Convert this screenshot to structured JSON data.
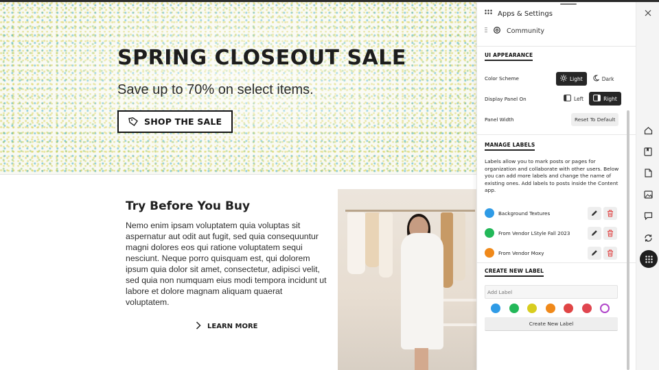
{
  "hero": {
    "title": "SPRING CLOSEOUT SALE",
    "subtitle": "Save up to 70% on select items.",
    "cta_label": "SHOP THE SALE"
  },
  "section": {
    "title": "Try Before You Buy",
    "body": "Nemo enim ipsam voluptatem quia voluptas sit aspernatur aut odit aut fugit, sed quia consequuntur magni dolores eos qui ratione voluptatem sequi nesciunt. Neque porro quisquam est, qui dolorem ipsum quia dolor sit amet, consectetur, adipisci velit, sed quia non numquam eius modi tempora incidunt ut labore et dolore magnam aliquam quaerat voluptatem.",
    "link_label": "LEARN MORE"
  },
  "panel": {
    "title": "Apps & Settings",
    "community_label": "Community",
    "ui_appearance": {
      "heading": "UI APPEARANCE",
      "color_scheme_label": "Color Scheme",
      "light_label": "Light",
      "dark_label": "Dark",
      "selected_scheme": "Light",
      "display_panel_label": "Display Panel On",
      "left_label": "Left",
      "right_label": "Right",
      "selected_side": "Right",
      "panel_width_label": "Panel Width",
      "reset_label": "Reset To Default"
    },
    "manage_labels": {
      "heading": "MANAGE LABELS",
      "description": "Labels allow you to mark posts or pages for organization and collaborate with other users. Below you can add more labels and change the name of existing ones. Add labels to posts inside the Content app.",
      "labels": [
        {
          "name": "Background Textures",
          "color": "#2f9be6"
        },
        {
          "name": "From Vendor LStyle Fall 2023",
          "color": "#23b859"
        },
        {
          "name": "From Vendor Moxy",
          "color": "#f0891a"
        }
      ]
    },
    "create_label": {
      "heading": "CREATE NEW LABEL",
      "input_placeholder": "Add Label",
      "swatches": [
        "#2f9be6",
        "#23b859",
        "#d8cd1f",
        "#f0891a",
        "#e04545",
        "#e0454f",
        "#b044c9"
      ],
      "button_label": "Create New Label"
    }
  },
  "rail": {
    "icons": [
      "home-icon",
      "bookmark-icon",
      "file-icon",
      "image-icon",
      "comment-icon",
      "sync-icon",
      "apps-grid-icon"
    ],
    "close_icon": "close-icon"
  },
  "colors": {
    "accent_dark": "#262626",
    "delete_red": "#e04545"
  }
}
